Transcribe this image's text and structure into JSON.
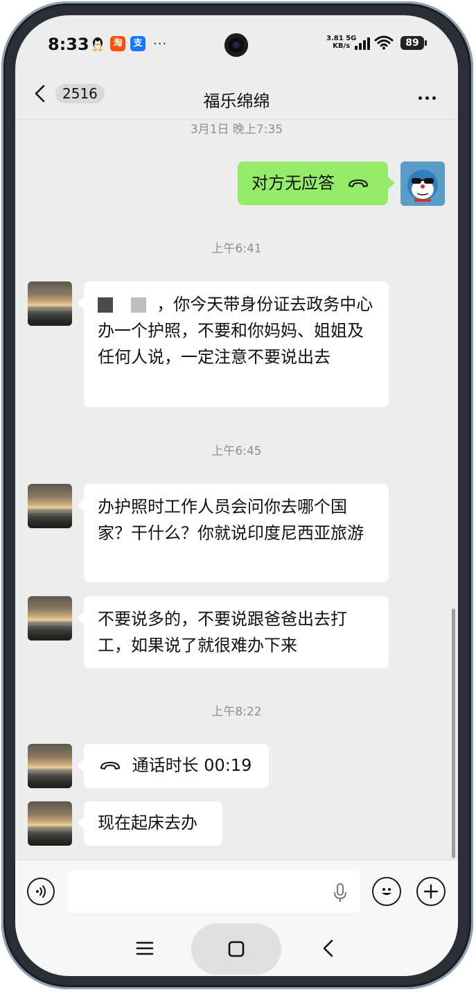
{
  "status_bar": {
    "time": "8:33",
    "more": "···",
    "net_speed_value": "3.81",
    "net_speed_unit": "KB/s",
    "net_type": "5G",
    "battery": "89",
    "apps": [
      {
        "icon": "qq-icon",
        "color": "#111111"
      },
      {
        "icon": "taobao-icon",
        "color": "#ff5000"
      },
      {
        "icon": "alipay-icon",
        "color": "#1677ff"
      }
    ]
  },
  "header": {
    "unread_count": "2516",
    "title": "福乐绵绵"
  },
  "messages": [
    {
      "type": "timestamp",
      "text": "3月1日 晚上7:35"
    },
    {
      "type": "call",
      "side": "right",
      "text": "对方无应答"
    },
    {
      "type": "timestamp",
      "text": "上午6:41"
    },
    {
      "type": "text",
      "side": "left",
      "prefix": "，",
      "text": "你今天带身份证去政务中心办一个护照，不要和你妈妈、姐姐及任何人说，一定注意不要说出去"
    },
    {
      "type": "timestamp",
      "text": "上午6:45"
    },
    {
      "type": "text",
      "side": "left",
      "text": "办护照时工作人员会问你去哪个国家？干什么？你就说印度尼西亚旅游"
    },
    {
      "type": "text",
      "side": "left",
      "text": "不要说多的，不要说跟爸爸出去打工，如果说了就很难办下来"
    },
    {
      "type": "timestamp",
      "text": "上午8:22"
    },
    {
      "type": "call",
      "side": "left",
      "text": "通话时长 00:19"
    },
    {
      "type": "text",
      "side": "left",
      "text": "现在起床去办"
    }
  ],
  "colors": {
    "background": "#ededed",
    "sent_bubble": "#95ec69",
    "received_bubble": "#ffffff"
  }
}
